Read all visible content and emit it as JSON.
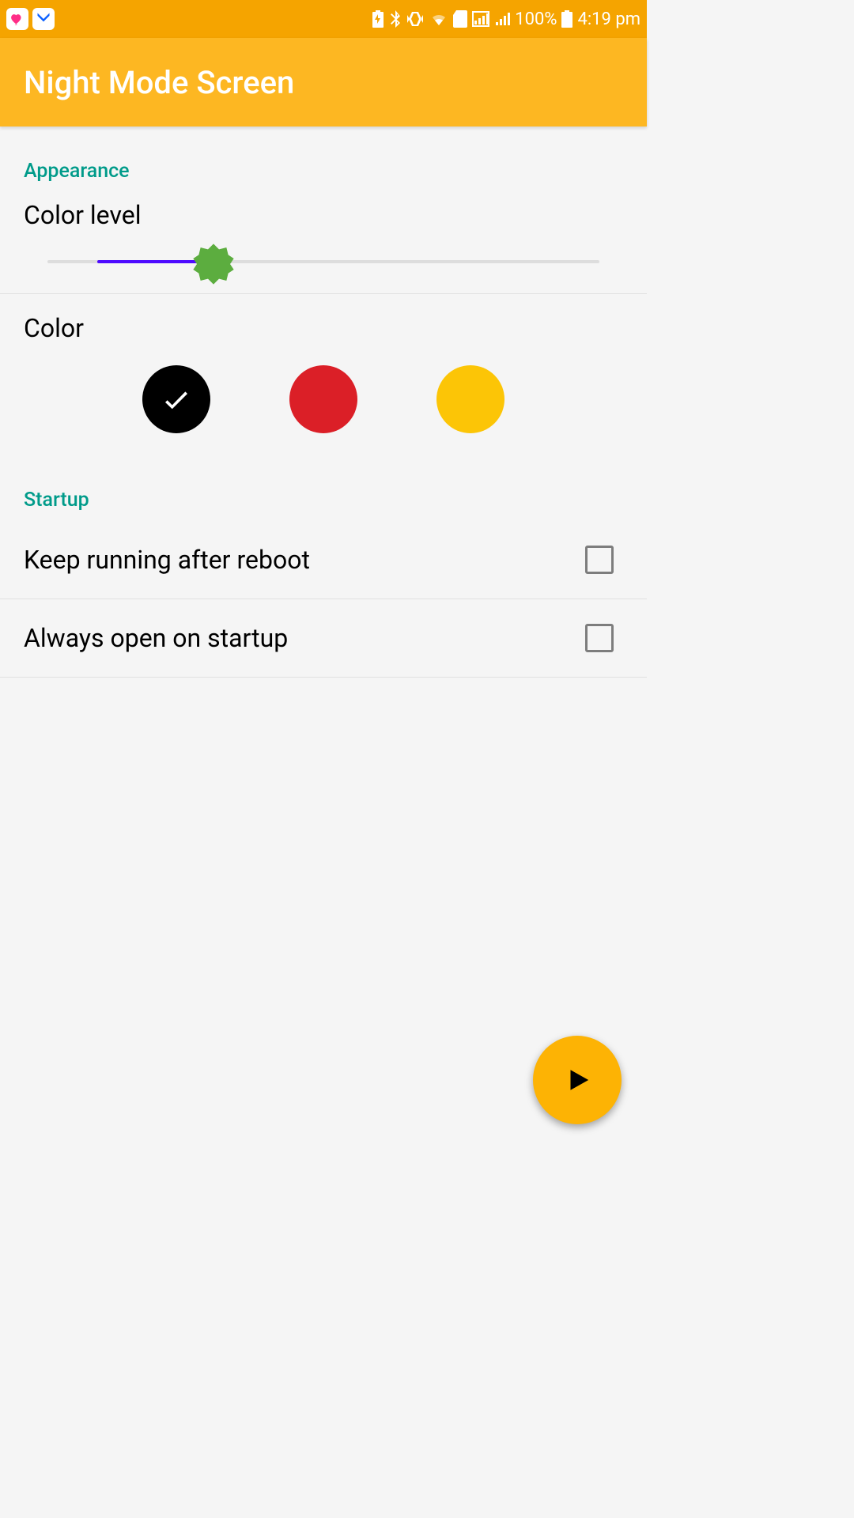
{
  "status": {
    "battery_text": "100%",
    "time_text": "4:19 pm"
  },
  "app": {
    "title": "Night Mode Screen"
  },
  "sections": {
    "appearance": {
      "label": "Appearance",
      "color_level_label": "Color level",
      "slider_value_percent": 33,
      "color_label": "Color",
      "colors": [
        {
          "hex": "#000000",
          "selected": true
        },
        {
          "hex": "#db1f27",
          "selected": false
        },
        {
          "hex": "#fcc506",
          "selected": false
        }
      ]
    },
    "startup": {
      "label": "Startup",
      "keep_running": {
        "label": "Keep running after reboot",
        "checked": false
      },
      "always_open": {
        "label": "Always open on startup",
        "checked": false
      }
    }
  },
  "fab": {
    "icon": "play"
  }
}
